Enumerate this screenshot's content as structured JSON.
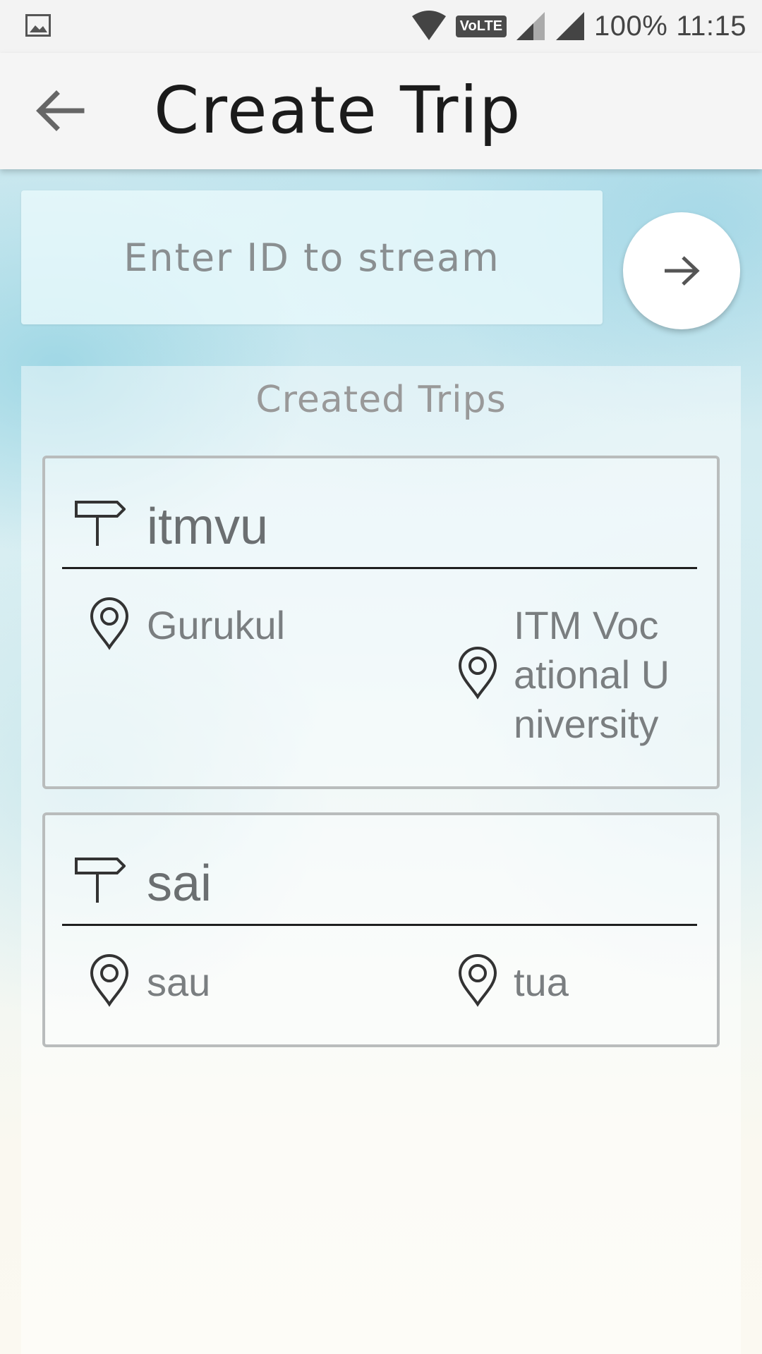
{
  "status_bar": {
    "battery": "100%",
    "time": "11:15",
    "network_badge": "VoLTE",
    "icons": [
      "gallery-icon",
      "wifi-icon",
      "signal-icon",
      "signal-icon"
    ]
  },
  "app_bar": {
    "title": "Create Trip",
    "back_icon": "arrow-left-icon"
  },
  "stream": {
    "placeholder": "Enter ID to stream",
    "go_icon": "arrow-right-icon"
  },
  "trips_section": {
    "title": "Created Trips",
    "trips": [
      {
        "name": "itmvu",
        "from": "Gurukul",
        "to": "ITM Voc ational U niversity"
      },
      {
        "name": "sai",
        "from": "sau",
        "to": "tua"
      }
    ]
  },
  "colors": {
    "accent_text": "#6b6f71",
    "border": "#b9bcbc"
  }
}
